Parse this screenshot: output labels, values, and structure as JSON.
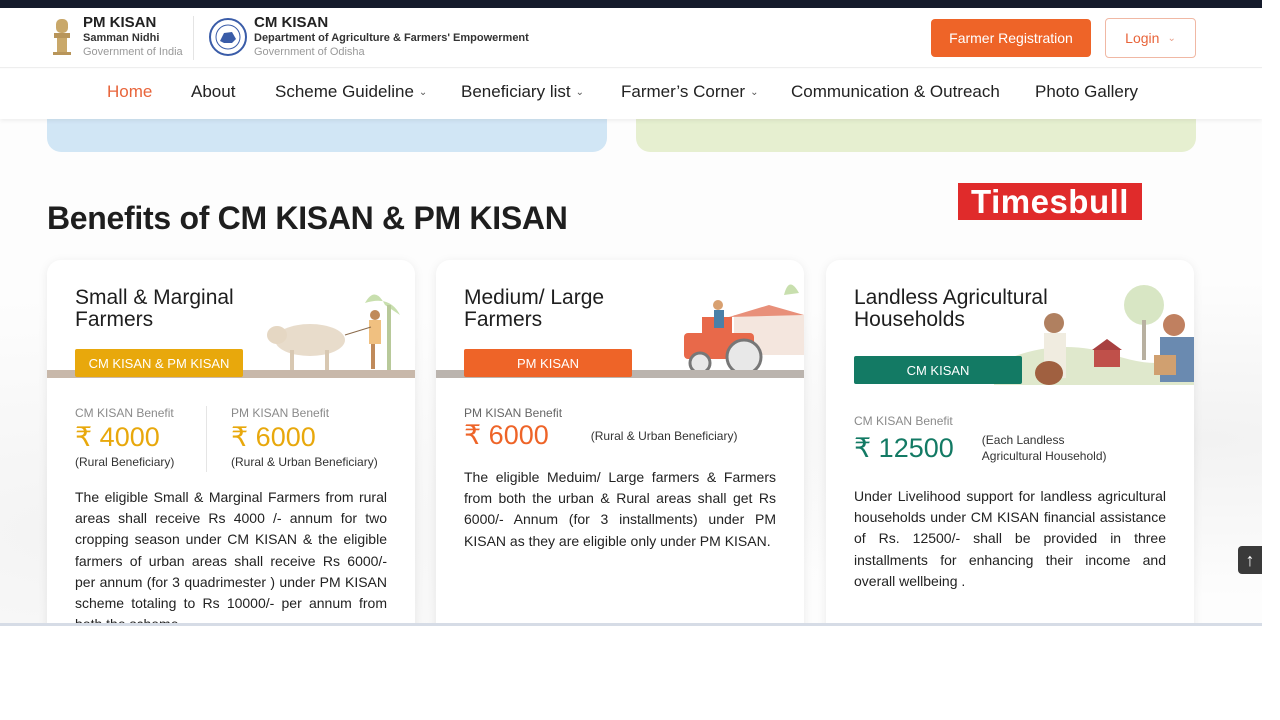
{
  "header": {
    "pm_logo": {
      "title": "PM KISAN",
      "subtitle": "Samman Nidhi",
      "gov": "Government of India"
    },
    "cm_logo": {
      "title": "CM KISAN",
      "subtitle": "Department of Agriculture & Farmers' Empowerment",
      "gov": "Government of Odisha"
    },
    "register_label": "Farmer Registration",
    "login_label": "Login",
    "colors": {
      "accent": "#ee6428"
    }
  },
  "nav": {
    "items": [
      {
        "label": "Home",
        "active": true
      },
      {
        "label": "About"
      },
      {
        "label": "Scheme Guideline",
        "dropdown": true
      },
      {
        "label": "Beneficiary list",
        "dropdown": true
      },
      {
        "label": "Farmer’s Corner",
        "dropdown": true
      },
      {
        "label": "Communication & Outreach"
      },
      {
        "label": "Photo Gallery"
      }
    ]
  },
  "section": {
    "title": "Benefits of CM KISAN & PM KISAN",
    "watermark": "Timesbull"
  },
  "cards": [
    {
      "title_line1": "Small & Marginal",
      "title_line2": "Farmers",
      "tag": "CM KISAN & PM KISAN",
      "tag_color": "#e8a80c",
      "benefits": [
        {
          "label": "CM KISAN Benefit",
          "amount": "₹ 4000",
          "note": "(Rural Beneficiary)"
        },
        {
          "label": "PM KISAN Benefit",
          "amount": "₹ 6000",
          "note": "(Rural & Urban Beneficiary)"
        }
      ],
      "amount_color": "#e8a80c",
      "description": "The eligible Small & Marginal Farmers from rural areas shall receive Rs 4000 /- annum for two cropping season under CM KISAN & the eligible farmers of urban areas shall receive Rs 6000/- per annum (for 3 quadrimester ) under PM KISAN scheme totaling to Rs 10000/- per annum from both the scheme."
    },
    {
      "title_line1": "Medium/ Large",
      "title_line2": "Farmers",
      "tag": "PM KISAN",
      "tag_color": "#ee6428",
      "benefits": [
        {
          "label": "PM KISAN Benefit",
          "amount": "₹ 6000",
          "note": "(Rural & Urban Beneficiary)"
        }
      ],
      "amount_color": "#ee6428",
      "description": "The eligible Meduim/ Large farmers & Farmers from both the urban & Rural areas shall get Rs 6000/- Annum (for 3 installments) under PM KISAN as they are eligible only under PM KISAN."
    },
    {
      "title_line1": "Landless Agricultural",
      "title_line2": "Households",
      "tag": "CM KISAN",
      "tag_color": "#137a64",
      "benefits": [
        {
          "label": "CM KISAN Benefit",
          "amount": "₹ 12500",
          "note_line1": "(Each Landless",
          "note_line2": "Agricultural Household)"
        }
      ],
      "amount_color": "#137a64",
      "description": "Under Livelihood support for landless agricultural households under CM KISAN financial assistance of Rs. 12500/- shall be provided in three installments for enhancing their income and overall wellbeing ."
    }
  ],
  "scroll_top": {
    "icon": "arrow-up-icon",
    "glyph": "↑"
  }
}
